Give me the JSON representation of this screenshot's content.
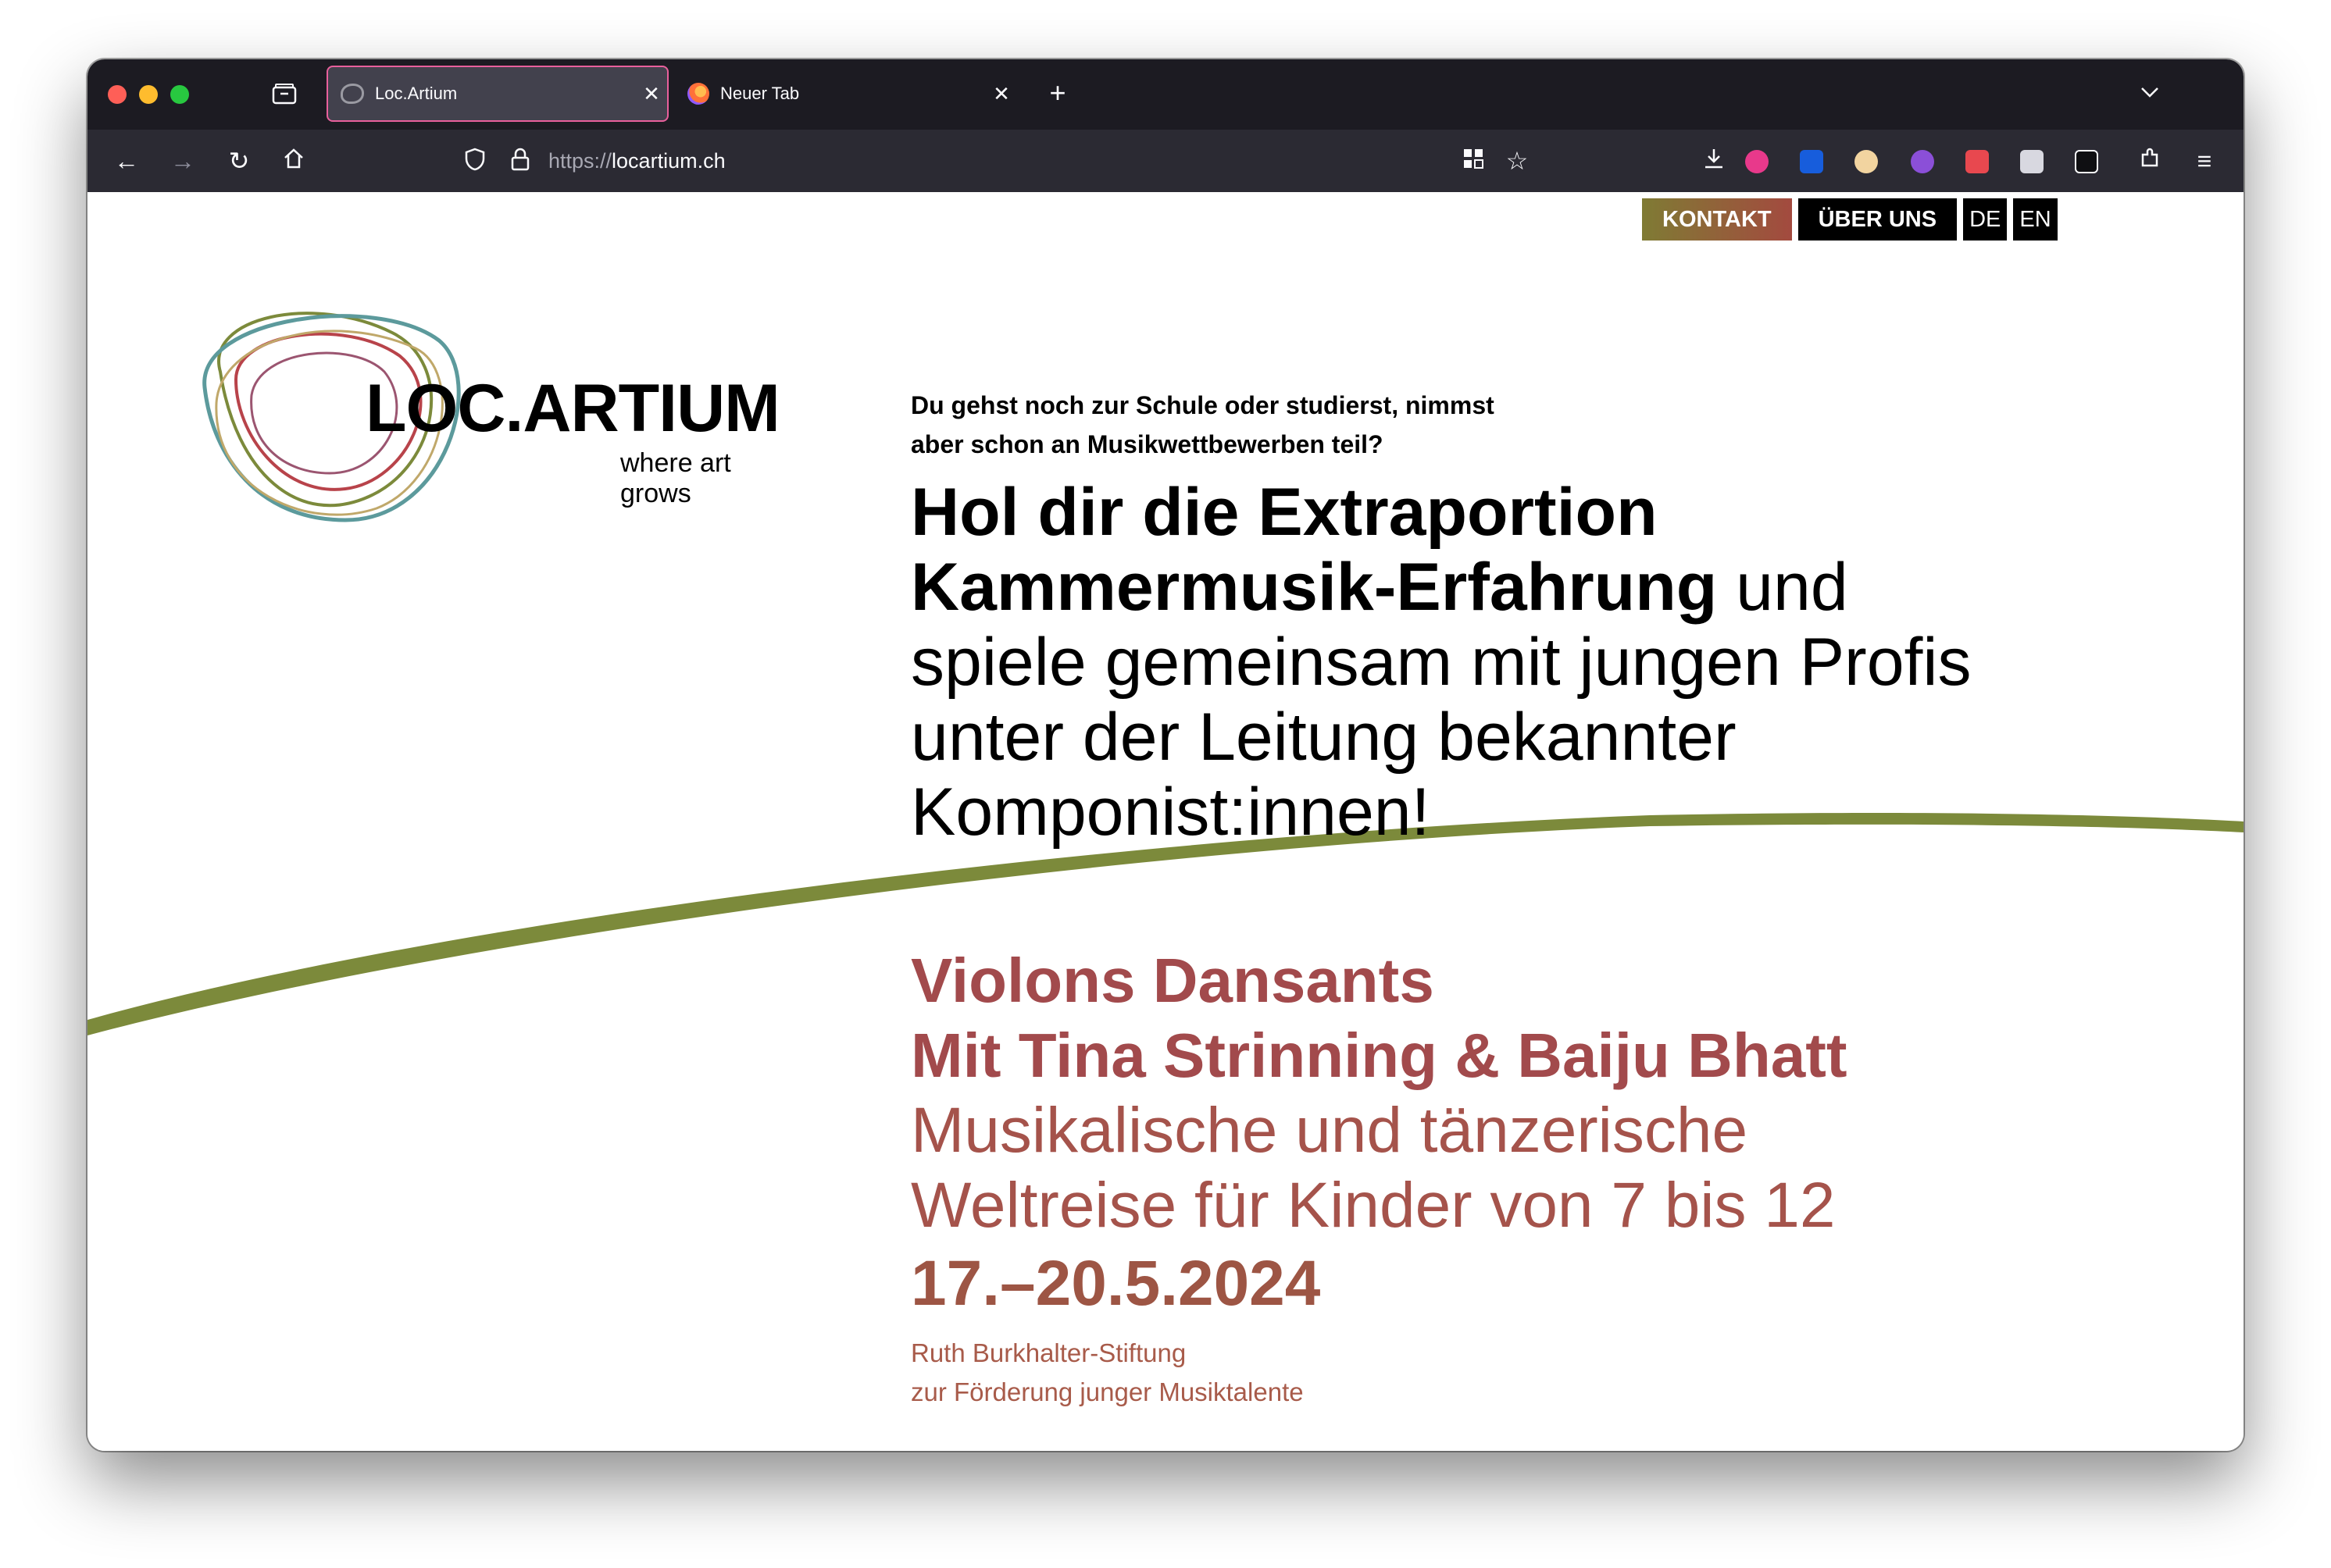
{
  "browser": {
    "tabs": [
      {
        "title": "Loc.Artium",
        "active": true
      },
      {
        "title": "Neuer Tab",
        "active": false
      }
    ],
    "url_protocol": "https://",
    "url_host": "locartium.ch",
    "icons": [
      "back-icon",
      "forward-icon",
      "reload-icon",
      "home-icon",
      "shield-icon",
      "lock-icon",
      "grid-icon",
      "star-icon",
      "download-icon",
      "extensions-icon",
      "menu-icon"
    ]
  },
  "nav": {
    "kontakt": "KONTAKT",
    "ueber_uns": "ÜBER UNS",
    "lang_de": "DE",
    "lang_en": "EN"
  },
  "logo": {
    "wordmark": "LOC.ARTIUM",
    "tagline": "where art grows"
  },
  "hero": {
    "intro_line1": "Du gehst noch zur Schule oder studierst, nimmst",
    "intro_line2": "aber schon an Musikwettbewerben teil?",
    "headline_bold_1": "Hol dir die Extraportion",
    "headline_bold_2": "Kammermusik-Erfahrung",
    "headline_rest_1": " und",
    "headline_rest_2": "spiele gemeinsam mit jungen Profis",
    "headline_rest_3": "unter der Leitung bekannter",
    "headline_rest_4": "Komponist:innen!"
  },
  "event": {
    "title_1": "Violons Dansants",
    "title_2": "Mit Tina Strinning & Baiju Bhatt",
    "subtitle_1": "Musikalische und tänzerische",
    "subtitle_2": "Weltreise für Kinder von 7 bis 12",
    "date": "17.–20.5.2024",
    "org_1": "Ruth Burkhalter-Stiftung",
    "org_2": "zur Förderung junger Musiktalente"
  },
  "colors": {
    "accent_green": "#7c8a3b",
    "accent_red": "#a24a4c",
    "tab_highlight": "#e8609c"
  }
}
